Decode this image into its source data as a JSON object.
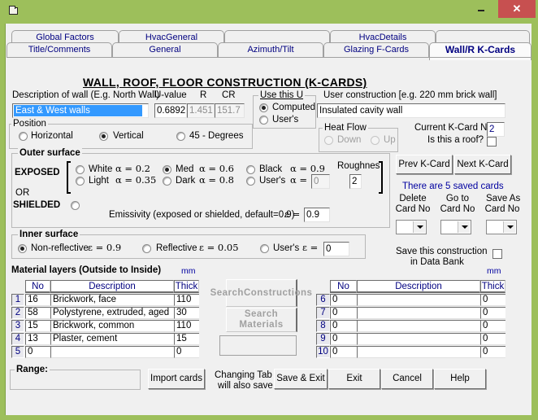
{
  "window": {
    "icon": "folder-window-icon",
    "minimize": "minimize-icon",
    "maximize": "maximize-icon",
    "close": "✕"
  },
  "tabs": {
    "row_back": [
      "Global Factors",
      "HvacGeneral",
      "",
      "HvacDetails",
      ""
    ],
    "row_front": [
      "Title/Comments",
      "General",
      "Azimuth/Tilt",
      "Glazing F-Cards"
    ],
    "active": "Wall/R K-Cards"
  },
  "heading": "WALL, ROOF, FLOOR CONSTRUCTION (K-CARDS)",
  "description": {
    "label": "Description of wall (E.g. North Wall)",
    "value": "East & West walls"
  },
  "uvalue": {
    "label": "U-value",
    "value": "0.6892"
  },
  "r": {
    "label": "R",
    "value": "1.451"
  },
  "cr": {
    "label": "CR",
    "value": "151.7"
  },
  "use_this_u": {
    "title": "Use this U",
    "options": [
      "Computed",
      "User's"
    ],
    "selected": "Computed"
  },
  "user_construction": {
    "label": "User construction [e.g. 220 mm brick wall]",
    "value": "Insulated cavity wall"
  },
  "position": {
    "title": "Position",
    "options": [
      "Horizontal",
      "Vertical",
      "45 - Degrees"
    ],
    "selected": "Vertical"
  },
  "heat_flow": {
    "title": "Heat Flow",
    "options": [
      "Down",
      "Up"
    ],
    "disabled": true
  },
  "current_kcard": {
    "label": "Current K-Card No",
    "value": "2"
  },
  "is_roof": {
    "label": "Is this a roof?",
    "checked": false
  },
  "outer_surface": {
    "title": "Outer surface",
    "exposed_label": "EXPOSED",
    "or_label": "OR",
    "shielded_label": "SHIELDED",
    "options": [
      {
        "name": "White",
        "alpha": "α = 0.2",
        "checked": false
      },
      {
        "name": "Med",
        "alpha": "α = 0.6",
        "checked": true
      },
      {
        "name": "Black",
        "alpha": "α = 0.9",
        "checked": false
      },
      {
        "name": "Light",
        "alpha": "α = 0.35",
        "checked": false
      },
      {
        "name": "Dark",
        "alpha": "α = 0.8",
        "checked": false
      },
      {
        "name": "User's",
        "alpha": "α =",
        "checked": false
      }
    ],
    "user_alpha": "0",
    "roughness_label": "Roughnes",
    "roughness_value": "2",
    "emissivity_label": "Emissivity (exposed or shielded, default=0.9)",
    "epsilon_label": "ε =",
    "emissivity_value": "0.9"
  },
  "inner_surface": {
    "title": "Inner surface",
    "options": [
      {
        "name": "Non-reflective",
        "eps": "ε = 0.9",
        "checked": true
      },
      {
        "name": "Reflective",
        "eps": "ε = 0.05",
        "checked": false
      },
      {
        "name": "User's",
        "eps": "ε =",
        "checked": false
      }
    ],
    "user_eps": "0"
  },
  "cards": {
    "prev": "Prev K-Card",
    "next": "Next K-Card",
    "saved_info": "There are 5 saved cards",
    "delete_label": [
      "Delete",
      "Card No"
    ],
    "goto_label": [
      "Go to",
      "Card No"
    ],
    "saveas_label": [
      "Save As",
      "Card No"
    ],
    "data_bank_label": [
      "Save this construction",
      "in Data Bank"
    ],
    "data_bank_checked": false
  },
  "materials": {
    "title": "Material layers (Outside to Inside)",
    "unit": "mm",
    "headers": [
      "No",
      "Description",
      "Thick"
    ],
    "rows_left": [
      {
        "idx": "1",
        "no": "16",
        "desc": "Brickwork, face",
        "thick": "110"
      },
      {
        "idx": "2",
        "no": "58",
        "desc": "Polystyrene, extruded, aged",
        "thick": "30"
      },
      {
        "idx": "3",
        "no": "15",
        "desc": "Brickwork, common",
        "thick": "110"
      },
      {
        "idx": "4",
        "no": "13",
        "desc": "Plaster, cement",
        "thick": "15"
      },
      {
        "idx": "5",
        "no": "0",
        "desc": "",
        "thick": "0"
      }
    ],
    "rows_right": [
      {
        "idx": "6",
        "no": "0",
        "desc": "",
        "thick": "0"
      },
      {
        "idx": "7",
        "no": "0",
        "desc": "",
        "thick": "0"
      },
      {
        "idx": "8",
        "no": "0",
        "desc": "",
        "thick": "0"
      },
      {
        "idx": "9",
        "no": "0",
        "desc": "",
        "thick": "0"
      },
      {
        "idx": "10",
        "no": "0",
        "desc": "",
        "thick": "0"
      }
    ],
    "search_constructions": [
      "Search",
      "Constructions"
    ],
    "search_materials": [
      "Search",
      "Materials"
    ]
  },
  "footer": {
    "range_label": "Range:",
    "import": "Import cards",
    "note": [
      "Changing Tab",
      "will also save"
    ],
    "save_exit": "Save & Exit",
    "exit": "Exit",
    "cancel": "Cancel",
    "help": "Help"
  }
}
